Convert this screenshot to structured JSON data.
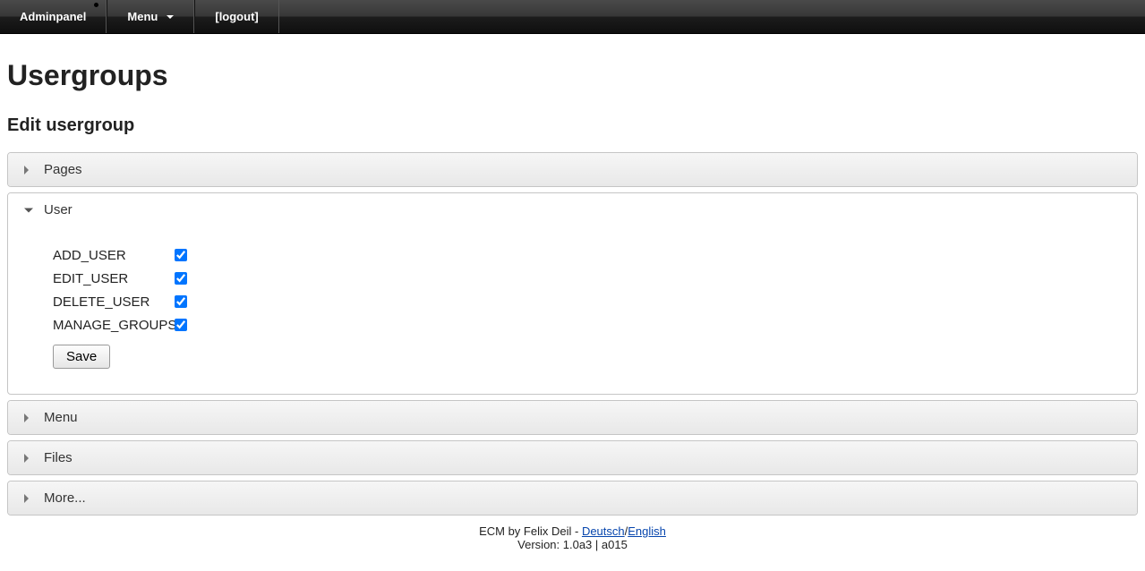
{
  "topbar": {
    "adminpanel": "Adminpanel",
    "menu": "Menu",
    "logout": "[logout]"
  },
  "page": {
    "title": "Usergroups",
    "subtitle": "Edit usergroup"
  },
  "accordion": {
    "pages": "Pages",
    "user": "User",
    "menu": "Menu",
    "files": "Files",
    "more": "More..."
  },
  "permissions": [
    {
      "label": "ADD_USER",
      "checked": true
    },
    {
      "label": "EDIT_USER",
      "checked": true
    },
    {
      "label": "DELETE_USER",
      "checked": true
    },
    {
      "label": "MANAGE_GROUPS",
      "checked": true
    }
  ],
  "buttons": {
    "save": "Save"
  },
  "footer": {
    "credit_prefix": "ECM by Felix Deil - ",
    "lang_de": "Deutsch",
    "sep": "/",
    "lang_en": "English",
    "version": "Version: 1.0a3 | a015"
  }
}
